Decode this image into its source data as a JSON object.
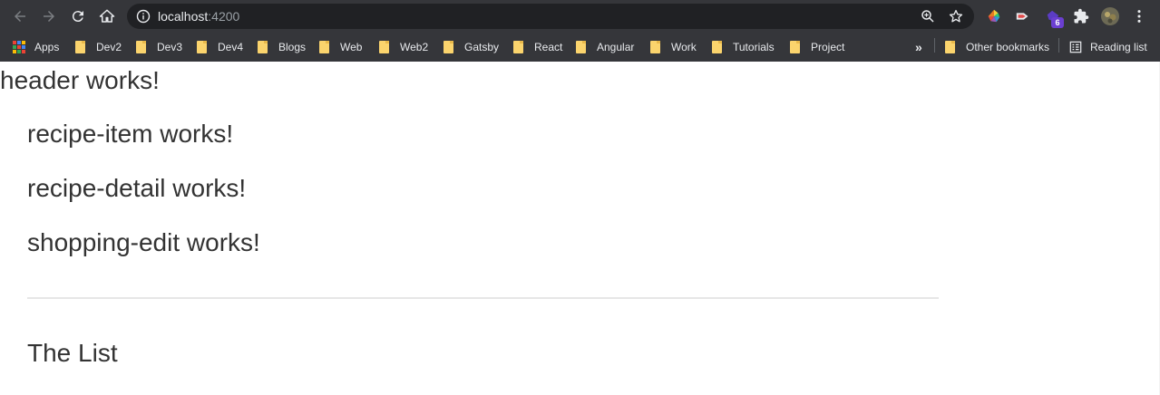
{
  "browser": {
    "url_host": "localhost",
    "url_port": ":4200",
    "extension_badge": "6"
  },
  "bookmarks": {
    "apps_label": "Apps",
    "items": [
      "Dev2",
      "Dev3",
      "Dev4",
      "Blogs",
      "Web",
      "Web2",
      "Gatsby",
      "React",
      "Angular",
      "Work",
      "Tutorials",
      "Project"
    ],
    "overflow": "»",
    "other": "Other bookmarks",
    "reading_list": "Reading list"
  },
  "content": {
    "header": "header works!",
    "lines": [
      "recipe-item works!",
      "recipe-detail works!",
      "shopping-edit works!"
    ],
    "list_title": "The List"
  },
  "colors": {
    "chrome_bg": "#35363a",
    "omnibox_bg": "#202124",
    "folder": "#fbd46d",
    "text": "#333333",
    "divider": "#e6e6e6"
  },
  "icons": {
    "back": "arrow-left-icon",
    "forward": "arrow-right-icon",
    "reload": "reload-icon",
    "home": "home-icon",
    "site_info": "info-icon",
    "zoom": "zoom-icon",
    "bookmark_star": "star-icon",
    "extensions": "puzzle-icon",
    "menu": "kebab-menu-icon"
  }
}
